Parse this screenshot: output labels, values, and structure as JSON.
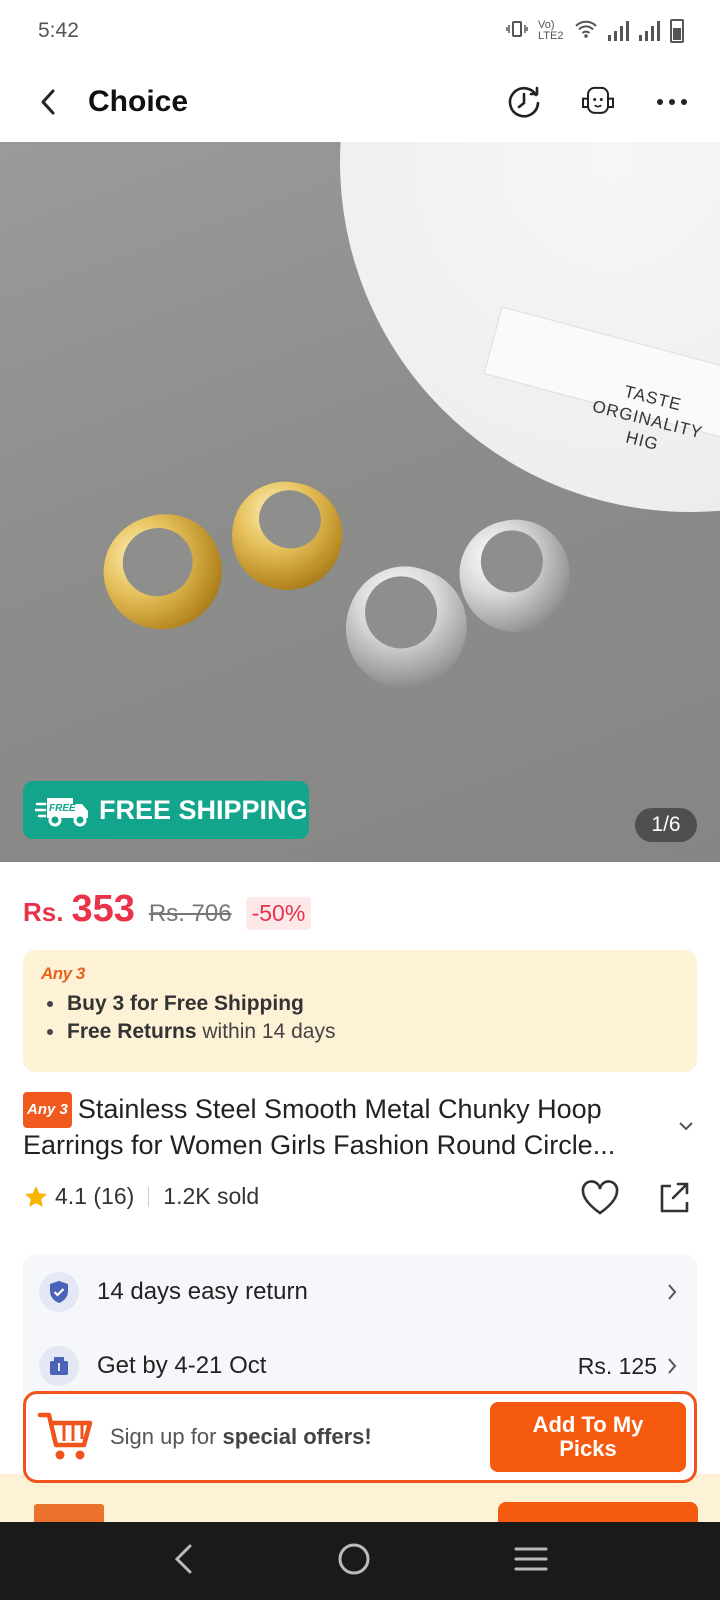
{
  "status_bar": {
    "time": "5:42",
    "network_label": "Vo) LTE2"
  },
  "header": {
    "title": "Choice"
  },
  "gallery": {
    "plate_text_line1": "TASTE",
    "plate_text_line2": "ORGINALITY HIG",
    "badge_free_tag": "FREE",
    "badge_text": "FREE SHIPPING",
    "pager": "1/6"
  },
  "price": {
    "currency": "Rs.",
    "current": "353",
    "original": "Rs. 706",
    "discount": "-50%"
  },
  "promo": {
    "tag": "Any 3",
    "line1_bold": "Buy 3 for  Free Shipping",
    "line2_bold": "Free Returns",
    "line2_rest": "within 14 days"
  },
  "product": {
    "tag": "Any 3",
    "title": "Stainless Steel Smooth Metal Chunky Hoop Earrings for Women Girls Fashion Round Circle...",
    "rating": "4.1",
    "reviews": "(16)",
    "sold": "1.2K sold"
  },
  "services": {
    "return_label": "14 days easy return",
    "delivery_label": "Get by 4-21 Oct",
    "delivery_price": "Rs. 125"
  },
  "offer_bar": {
    "text_prefix": "Sign up for",
    "text_bold": "special offers!",
    "button_label": "Add To My Picks"
  },
  "colors": {
    "accent": "#f55a0f",
    "price": "#e8334a",
    "shipping_badge": "#12a58b",
    "promo_bg": "#fdf1d6"
  }
}
